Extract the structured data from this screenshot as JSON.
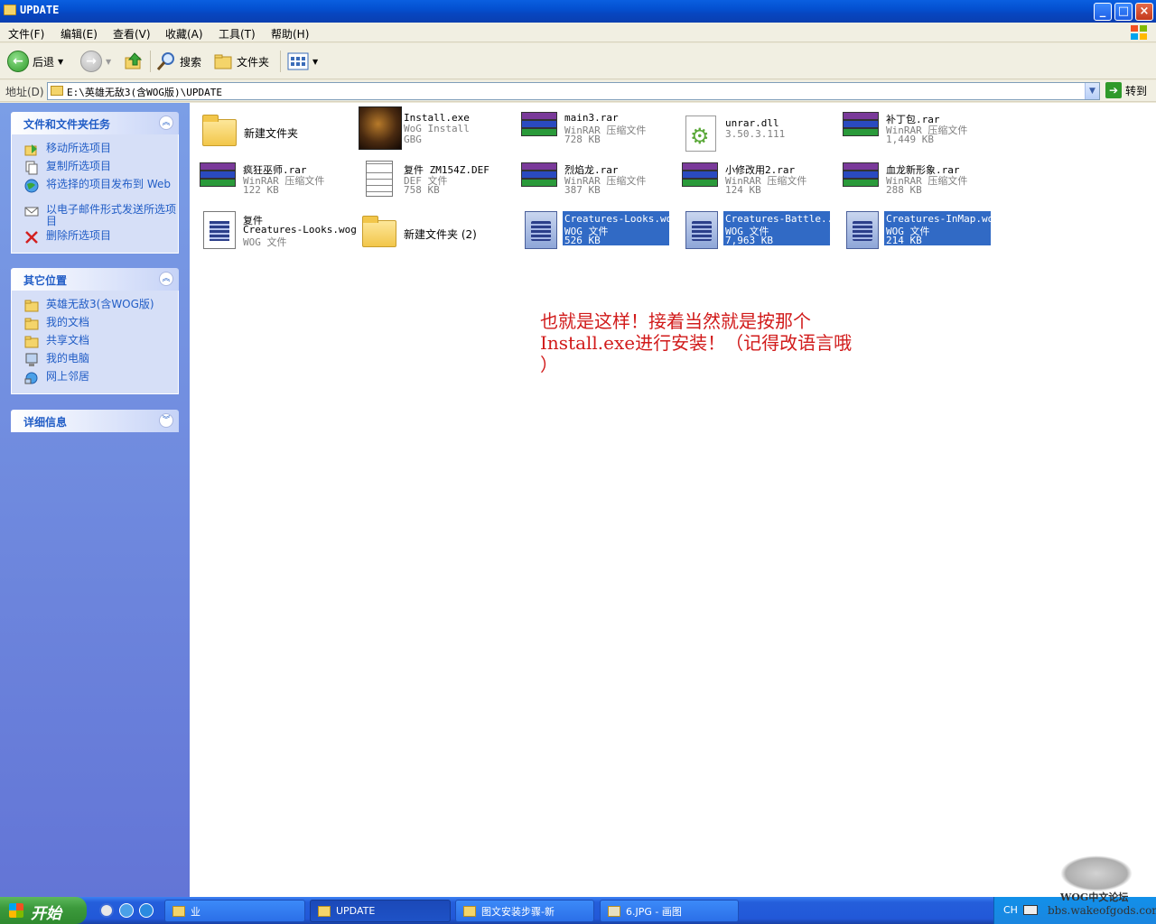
{
  "window": {
    "title": "UPDATE",
    "controls": {
      "minimize": "_",
      "maximize": "□",
      "close": "×"
    }
  },
  "menu": [
    "文件(F)",
    "编辑(E)",
    "查看(V)",
    "收藏(A)",
    "工具(T)",
    "帮助(H)"
  ],
  "toolbar": {
    "back_label": "后退",
    "search_label": "搜索",
    "folders_label": "文件夹"
  },
  "address": {
    "label": "地址(D)",
    "path": "E:\\英雄无敌3(含WOG版)\\UPDATE",
    "go_label": "转到"
  },
  "tasks_panel": {
    "title": "文件和文件夹任务",
    "items": [
      {
        "label": "移动所选项目",
        "icon": "move-icon"
      },
      {
        "label": "复制所选项目",
        "icon": "copy-icon"
      },
      {
        "label": "将选择的项目发布到 Web",
        "icon": "globe-icon"
      },
      {
        "label": "以电子邮件形式发送所选项目",
        "icon": "email-icon"
      },
      {
        "label": "删除所选项目",
        "icon": "delete-icon"
      }
    ]
  },
  "places_panel": {
    "title": "其它位置",
    "items": [
      {
        "label": "英雄无敌3(含WOG版)",
        "icon": "folder-icon"
      },
      {
        "label": "我的文档",
        "icon": "folder-icon"
      },
      {
        "label": "共享文档",
        "icon": "folder-icon"
      },
      {
        "label": "我的电脑",
        "icon": "computer-icon"
      },
      {
        "label": "网上邻居",
        "icon": "network-icon"
      }
    ]
  },
  "details_panel": {
    "title": "详细信息"
  },
  "files": [
    {
      "name": "新建文件夹",
      "line2": "",
      "line3": "",
      "type": "folder",
      "selected": false
    },
    {
      "name": "Install.exe",
      "line2": "WoG Install",
      "line3": "GBG",
      "type": "exe",
      "selected": false
    },
    {
      "name": "main3.rar",
      "line2": "WinRAR 压缩文件",
      "line3": "728 KB",
      "type": "rar",
      "selected": false
    },
    {
      "name": "unrar.dll",
      "line2": "3.50.3.111",
      "line3": "",
      "type": "dll",
      "selected": false
    },
    {
      "name": "补丁包.rar",
      "line2": "WinRAR 压缩文件",
      "line3": "1,449 KB",
      "type": "rar",
      "selected": false
    },
    {
      "name": "疯狂巫师.rar",
      "line2": "WinRAR 压缩文件",
      "line3": "122 KB",
      "type": "rar",
      "selected": false
    },
    {
      "name": "复件 ZM154Z.DEF",
      "line2": "DEF 文件",
      "line3": "758 KB",
      "type": "doc",
      "selected": false
    },
    {
      "name": "烈焰龙.rar",
      "line2": "WinRAR 压缩文件",
      "line3": "387 KB",
      "type": "rar",
      "selected": false
    },
    {
      "name": "小修改用2.rar",
      "line2": "WinRAR 压缩文件",
      "line3": "124 KB",
      "type": "rar",
      "selected": false
    },
    {
      "name": "血龙新形象.rar",
      "line2": "WinRAR 压缩文件",
      "line3": "288 KB",
      "type": "rar",
      "selected": false
    },
    {
      "name": "复件",
      "line2": "Creatures-Looks.wog",
      "line3": "WOG 文件",
      "type": "wogw",
      "selected": false
    },
    {
      "name": "新建文件夹 (2)",
      "line2": "",
      "line3": "",
      "type": "folder",
      "selected": false
    },
    {
      "name": "Creatures-Looks.wog",
      "line2": "WOG 文件",
      "line3": "526 KB",
      "type": "wog",
      "selected": true
    },
    {
      "name": "Creatures-Battle...",
      "line2": "WOG 文件",
      "line3": "7,963 KB",
      "type": "wog",
      "selected": true
    },
    {
      "name": "Creatures-InMap.wog",
      "line2": "WOG 文件",
      "line3": "214 KB",
      "type": "wog",
      "selected": true
    }
  ],
  "annotation": {
    "line1": "也就是这样！接着当然就是按那个",
    "line2": "Install.exe进行安装！（记得改语言哦",
    "line3": "）"
  },
  "watermark": {
    "line1": "WOG中文论坛",
    "line2": "bbs.wakeofgods.com"
  },
  "taskbar": {
    "start_label": "开始",
    "buttons": [
      "业",
      "UPDATE",
      "图文安装步骤-新",
      "6.JPG - 画图"
    ],
    "tray_lang": "CH"
  },
  "colors": {
    "selection": "#316ac5",
    "annotation": "#d11a1a",
    "taskpane_link": "#215dc6"
  }
}
